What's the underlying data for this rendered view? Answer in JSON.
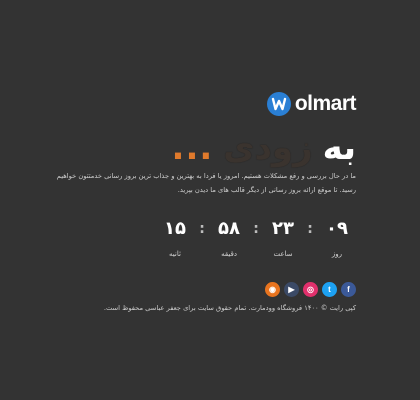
{
  "brand": {
    "logo_letter": "w",
    "name": "olmart"
  },
  "hero": {
    "title": "به",
    "subtitle": "زودی",
    "dots": "..."
  },
  "description": {
    "line1": "ما در حال بررسی و رفع مشکلات هستیم. امروز یا فردا به بهترین و جذاب ترین بروز رسانی خدمتتون خواهیم",
    "line2": "رسید. تا موقع ارائه بروز رسانی از دیگر قالب های ما دیدن بپرید."
  },
  "countdown": {
    "days": "۰۹",
    "hours": "۲۳",
    "minutes": "۵۸",
    "seconds": "۱۵",
    "separator": ":",
    "days_label": "روز",
    "hours_label": "ساعت",
    "minutes_label": "دقیقه",
    "seconds_label": "ثانیه"
  },
  "social": [
    {
      "name": "facebook",
      "glyph": "f",
      "color": "#3b5998"
    },
    {
      "name": "twitter",
      "glyph": "t",
      "color": "#1da1f2"
    },
    {
      "name": "instagram",
      "glyph": "◎",
      "color": "#e1306c"
    },
    {
      "name": "youtube",
      "glyph": "▶",
      "color": "#3b4a66"
    },
    {
      "name": "rss",
      "glyph": "◉",
      "color": "#e8741f"
    }
  ],
  "footer": {
    "copyright": "کپی رایت © ۱۴۰۰ فروشگاه وودمارت. تمام حقوق سایت برای جعفر عباسی محفوظ است."
  },
  "colors": {
    "background": "#333333",
    "accent": "#e07a2c",
    "brand_blue": "#2a7fd4"
  }
}
